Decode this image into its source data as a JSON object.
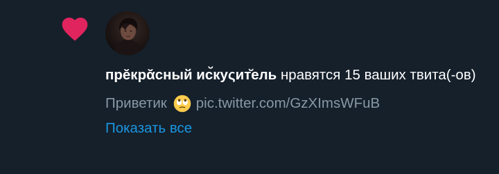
{
  "notification": {
    "type_icon": "heart-icon",
    "avatar": "user-avatar",
    "username": "прĕкрᾰсный иc̆куςит̆ель",
    "action_text": " нравятся 15 ваших твита(-ов)",
    "tweet_text": "Приветик",
    "tweet_emoji": "rolling-eyes-emoji",
    "tweet_link": "pic.twitter.com/GzXImsWFuB",
    "show_all_label": "Показать все"
  },
  "colors": {
    "background": "#15202b",
    "heart": "#e0245e",
    "primary_text": "#ffffff",
    "secondary_text": "#8899a6",
    "link": "#1b95e0"
  }
}
